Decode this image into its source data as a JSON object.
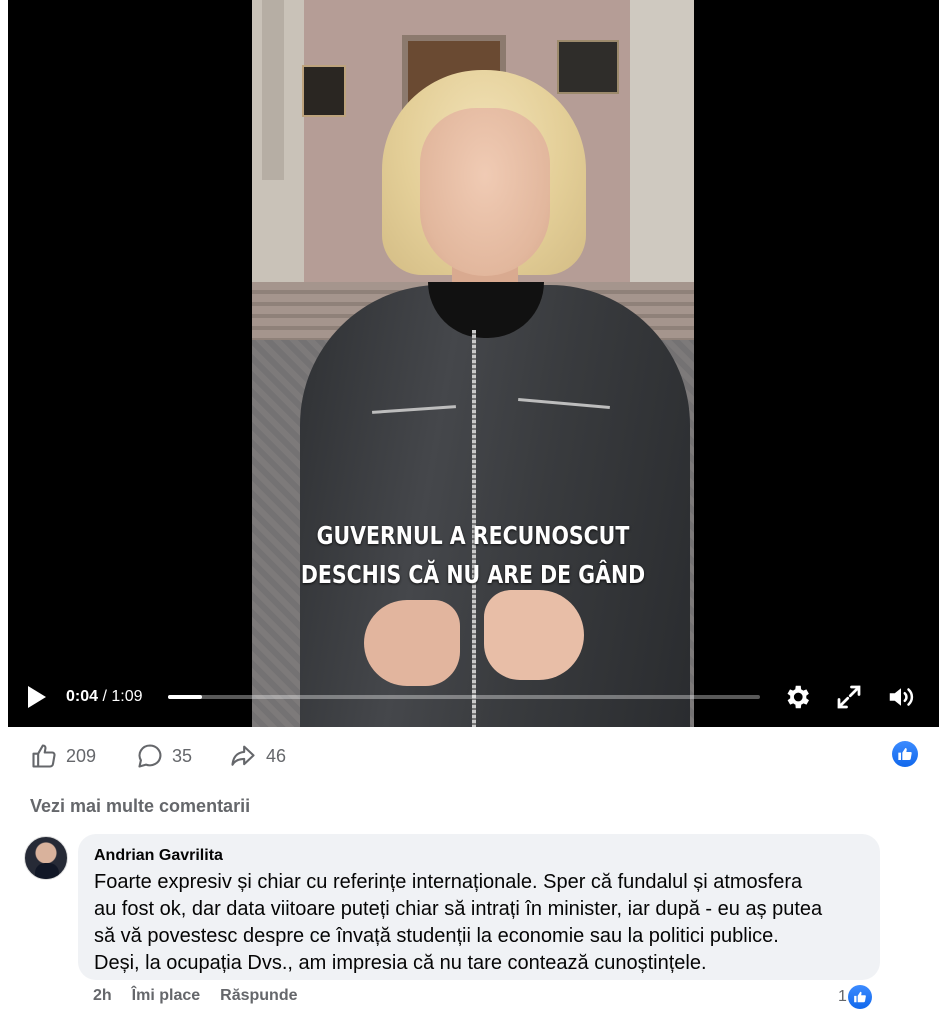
{
  "video": {
    "caption_line1": "GUVERNUL A RECUNOSCUT",
    "caption_line2": "DESCHIS CĂ NU ARE DE GÂND",
    "current_time": "0:04",
    "separator": " / ",
    "duration": "1:09",
    "progress_fraction": 0.058,
    "icons": [
      "play-icon",
      "settings-icon",
      "fullscreen-icon",
      "volume-icon"
    ]
  },
  "actions": {
    "likes": "209",
    "comments": "35",
    "shares": "46",
    "accent": "#1877f2"
  },
  "more_comments_label": "Vezi mai multe comentarii",
  "comment": {
    "author": "Andrian Gavrilita",
    "text_lines": [
      "Foarte expresiv și chiar cu referințe internaționale. Sper că fundalul și atmosfera",
      "au fost ok, dar data viitoare puteți chiar să intrați în minister, iar după - eu aș putea",
      "să vă povestesc despre ce învață studenții la economie sau la politici publice.",
      "Deși, la ocupația Dvs., am impresia că nu tare contează cunoștințele."
    ],
    "time": "2h",
    "like_label": "Îmi place",
    "reply_label": "Răspunde",
    "like_count": "1"
  }
}
